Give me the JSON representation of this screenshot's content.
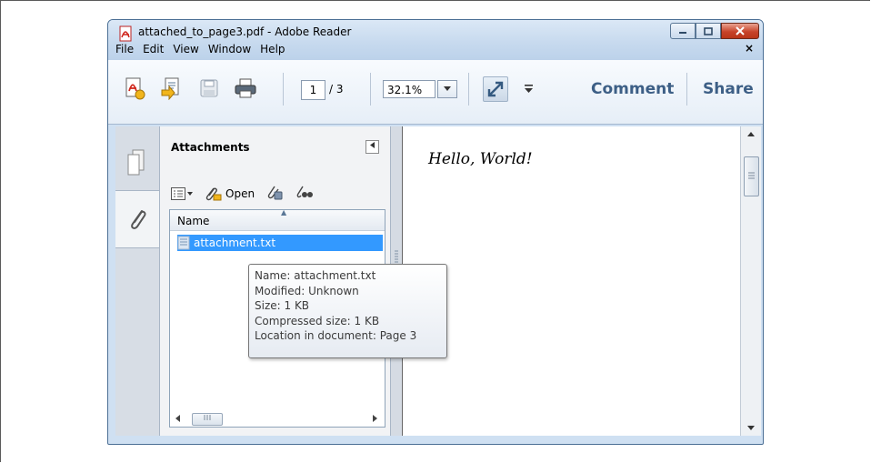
{
  "window": {
    "title": "attached_to_page3.pdf - Adobe Reader"
  },
  "menu": {
    "items": [
      "File",
      "Edit",
      "View",
      "Window",
      "Help"
    ],
    "close_label": "×"
  },
  "toolbar": {
    "page_current": "1",
    "page_total": "/ 3",
    "zoom": "32.1%",
    "comment_label": "Comment",
    "share_label": "Share"
  },
  "panel": {
    "title": "Attachments",
    "open_label": "Open",
    "column_header": "Name",
    "rows": [
      {
        "label": "attachment.txt"
      }
    ]
  },
  "document": {
    "text": "Hello, World!"
  },
  "tooltip": {
    "lines": [
      "Name: attachment.txt",
      "Modified: Unknown",
      "Size: 1 KB",
      "Compressed size: 1 KB",
      "Location in document: Page 3"
    ]
  },
  "colors": {
    "selection": "#3399ff",
    "link": "#3d5f86",
    "close_button": "#c8442a"
  },
  "icons": {
    "title": "adobe-pdf-icon",
    "toolbar": [
      "create-pdf-icon",
      "edit-file-icon",
      "save-icon",
      "print-icon",
      "fullscreen-icon"
    ],
    "rail": [
      "pages-icon",
      "paperclip-icon"
    ]
  }
}
